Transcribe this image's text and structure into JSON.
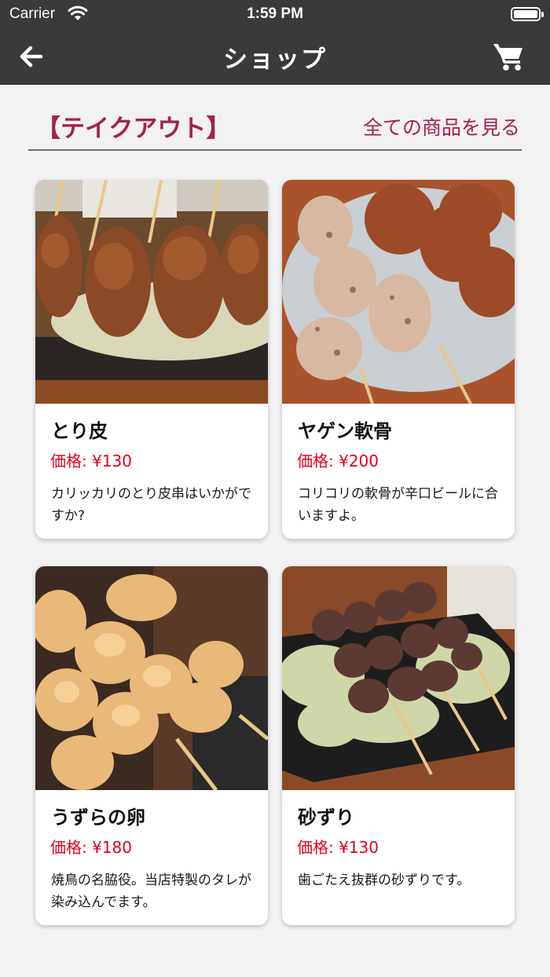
{
  "status_bar": {
    "carrier": "Carrier",
    "time": "1:59 PM"
  },
  "header": {
    "title": "ショップ",
    "back_icon": "arrow-left-icon",
    "cart_icon": "cart-icon",
    "background": "#3b3a39"
  },
  "section": {
    "title": "【テイクアウト】",
    "see_all": "全ての商品を見る",
    "accent": "#a3224f"
  },
  "products": [
    {
      "name": "とり皮",
      "price": "価格: ¥130",
      "description": "カリッカリのとり皮串はいかがですか?"
    },
    {
      "name": "ヤゲン軟骨",
      "price": "価格: ¥200",
      "description": "コリコリの軟骨が辛口ビールに合いますよ。"
    },
    {
      "name": "うずらの卵",
      "price": "価格: ¥180",
      "description": "焼鳥の名脇役。当店特製のタレが染み込んでます。"
    },
    {
      "name": "砂ずり",
      "price": "価格: ¥130",
      "description": "歯ごたえ抜群の砂ずりです。"
    }
  ],
  "price_color": "#e0001b"
}
